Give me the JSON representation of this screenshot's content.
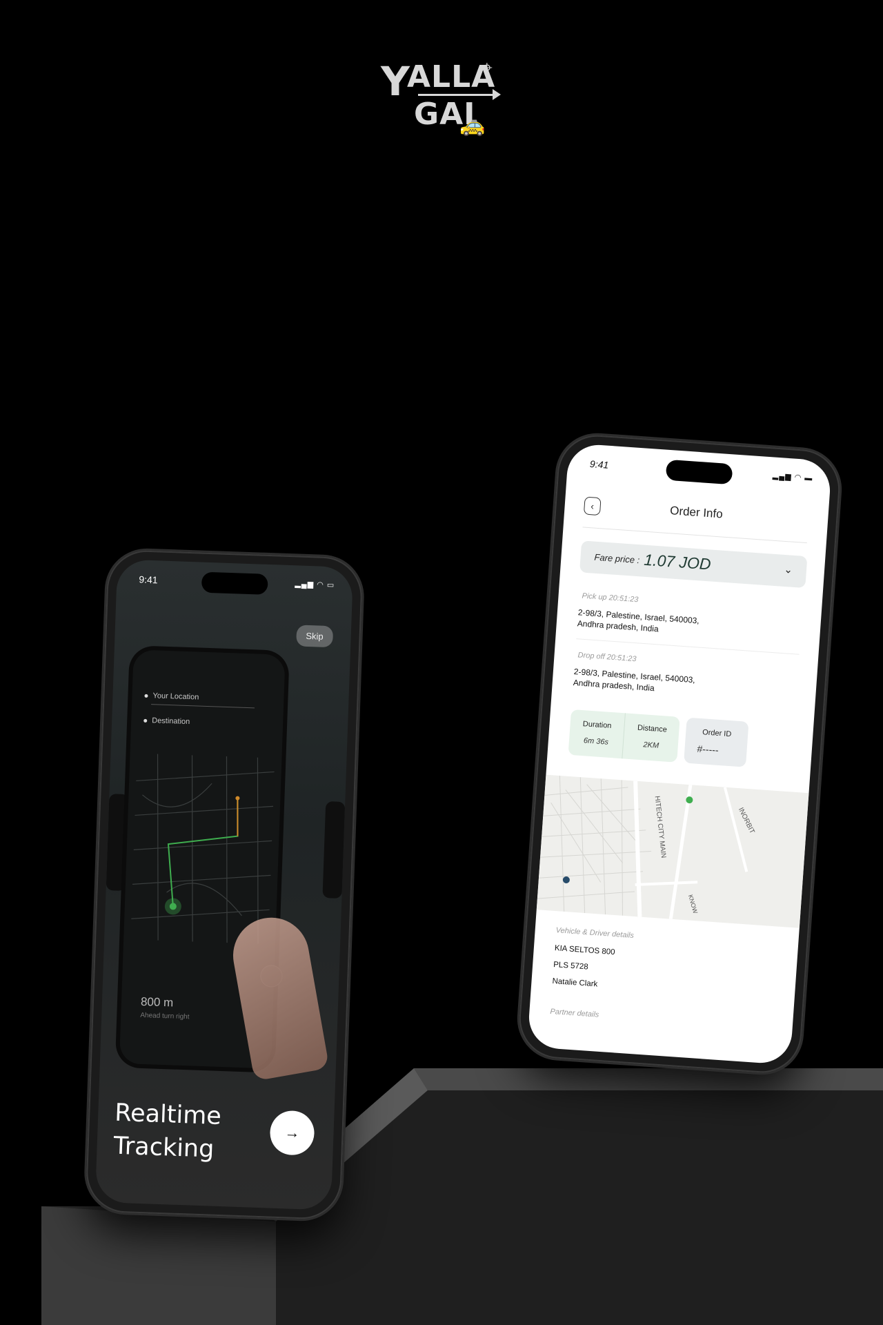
{
  "logo": {
    "text_line1": "ALLA",
    "text_line2": "GAI",
    "letter": "Y"
  },
  "left_phone": {
    "status_time": "9:41",
    "skip_label": "Skip",
    "your_location": "Your Location",
    "destination": "Destination",
    "distance": "800 m",
    "distance_hint": "Ahead turn right",
    "title_line1": "Realtime",
    "title_line2": "Tracking",
    "next_icon": "→"
  },
  "right_phone": {
    "status_time": "9:41",
    "back_icon": "‹",
    "title": "Order Info",
    "fare_label": "Fare price :",
    "fare_value": "1.07 JOD",
    "chevron_icon": "⌄",
    "pickup_label": "Pick up 20:51:23",
    "pickup_address_line1": "2-98/3, Palestine, Israel, 540003,",
    "pickup_address_line2": "Andhra pradesh, India",
    "dropoff_label": "Drop off 20:51:23",
    "dropoff_address_line1": "2-98/3, Palestine, Israel, 540003,",
    "dropoff_address_line2": "Andhra pradesh, India",
    "duration_label": "Duration",
    "duration_value": "6m 36s",
    "distance_label": "Distance",
    "distance_value": "2KM",
    "order_id_label": "Order ID",
    "order_id_value": "#-----",
    "map_road_label": "HITECH CITY MAIN",
    "map_road_label2": "INORBIT",
    "map_road_label3": "KNOW",
    "vehicle_section_label": "Vehicle & Driver details",
    "vehicle_model": "KIA SELTOS 800",
    "plate": "PLS 5728",
    "driver_name": "Natalie Clark",
    "partner_section_label": "Partner details"
  },
  "colors": {
    "background": "#000000",
    "accent_green": "#3fae4f",
    "stats_bg": "#e7f3ea"
  }
}
